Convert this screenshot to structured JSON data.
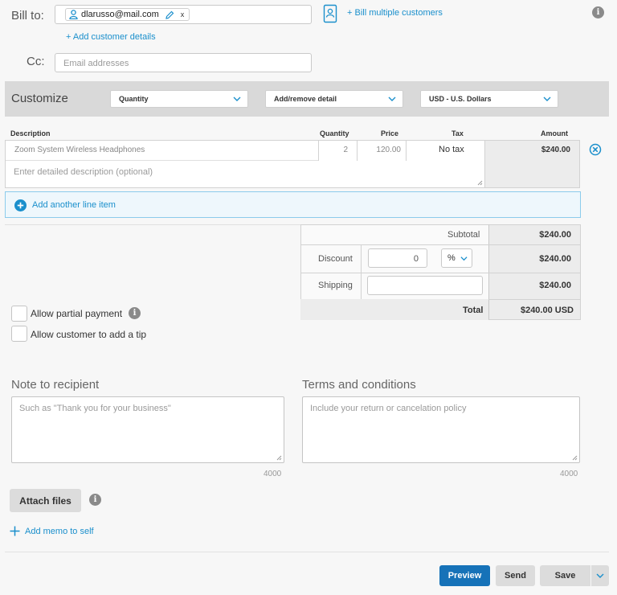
{
  "bill_to": {
    "label": "Bill to:",
    "customer_email": "dlarusso@mail.com",
    "remove_glyph": "x",
    "add_details_link": "+ Add customer details",
    "bill_multiple_link": "+ Bill multiple customers"
  },
  "cc": {
    "label": "Cc:",
    "placeholder": "Email addresses"
  },
  "customize": {
    "label": "Customize",
    "quantity_select": "Quantity",
    "detail_select": "Add/remove detail",
    "currency_select": "USD - U.S. Dollars"
  },
  "table": {
    "headers": {
      "description": "Description",
      "quantity": "Quantity",
      "price": "Price",
      "tax": "Tax",
      "amount": "Amount"
    },
    "items": [
      {
        "description": "Zoom System Wireless Headphones",
        "quantity": "2",
        "price": "120.00",
        "tax": "No tax",
        "amount": "$240.00",
        "detail_placeholder": "Enter detailed description (optional)"
      }
    ],
    "add_line_item": "Add another line item"
  },
  "totals": {
    "subtotal_label": "Subtotal",
    "subtotal_value": "$240.00",
    "discount_label": "Discount",
    "discount_input": "0",
    "discount_unit": "%",
    "discount_value": "$240.00",
    "shipping_label": "Shipping",
    "shipping_value": "$240.00",
    "total_label": "Total",
    "total_value": "$240.00 USD"
  },
  "options": {
    "partial_payment": "Allow partial payment",
    "tip": "Allow customer to add a tip"
  },
  "note": {
    "title": "Note to recipient",
    "placeholder": "Such as \"Thank you for your business\"",
    "counter": "4000"
  },
  "terms": {
    "title": "Terms and conditions",
    "placeholder": "Include your return or cancelation policy",
    "counter": "4000"
  },
  "attach_files": "Attach files",
  "add_memo": "Add memo to self",
  "footer": {
    "preview": "Preview",
    "send": "Send",
    "save": "Save"
  },
  "colors": {
    "accent": "#1a8fcc",
    "preview_button": "#1672b8",
    "customize_bar": "#d9d9d9"
  },
  "icons": {
    "info": "info-icon",
    "person": "person-icon",
    "pencil": "pencil-icon",
    "contact_book": "contact-book-icon",
    "remove_circle": "remove-circle-icon",
    "plus_circle": "plus-circle-icon",
    "chevron": "chevron-down-icon"
  }
}
